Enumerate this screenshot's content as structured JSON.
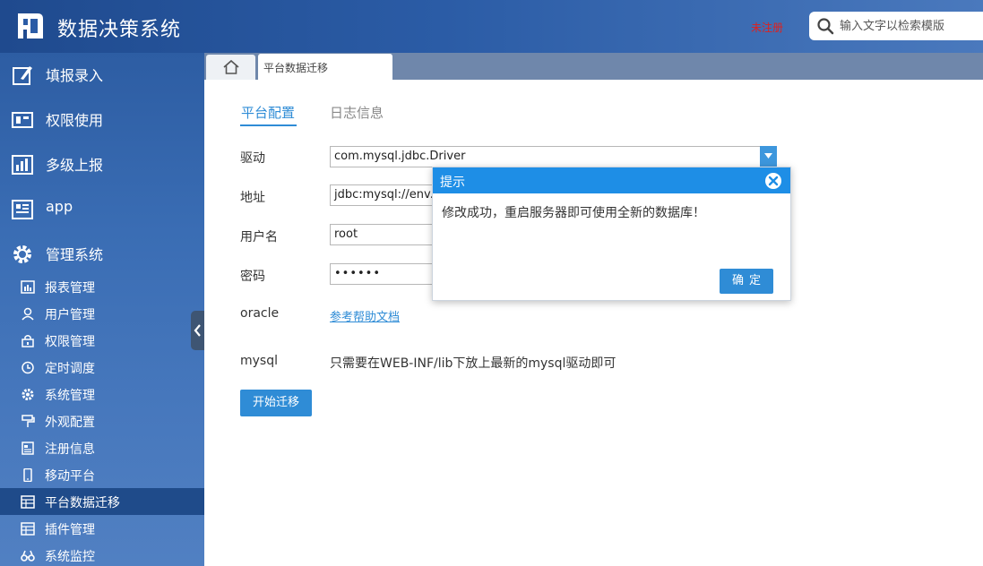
{
  "header": {
    "title": "数据决策系统",
    "unregistered": "未注册",
    "search_placeholder": "输入文字以检索模版"
  },
  "sidebar": {
    "main_items": [
      {
        "label": "填报录入",
        "icon": "edit-icon"
      },
      {
        "label": "权限使用",
        "icon": "permission-icon"
      },
      {
        "label": "多级上报",
        "icon": "chart-icon"
      },
      {
        "label": "app",
        "icon": "app-icon"
      },
      {
        "label": "管理系统",
        "icon": "gear-icon"
      }
    ],
    "sub_items": [
      {
        "label": "报表管理",
        "icon": "report-icon"
      },
      {
        "label": "用户管理",
        "icon": "user-icon"
      },
      {
        "label": "权限管理",
        "icon": "lock-icon"
      },
      {
        "label": "定时调度",
        "icon": "clock-icon"
      },
      {
        "label": "系统管理",
        "icon": "gear-icon"
      },
      {
        "label": "外观配置",
        "icon": "brush-icon"
      },
      {
        "label": "注册信息",
        "icon": "document-icon"
      },
      {
        "label": "移动平台",
        "icon": "phone-icon"
      },
      {
        "label": "平台数据迁移",
        "icon": "table-icon",
        "active": true
      },
      {
        "label": "插件管理",
        "icon": "table-icon"
      },
      {
        "label": "系统监控",
        "icon": "binoculars-icon"
      }
    ]
  },
  "tabs": {
    "open_tab": "平台数据迁移"
  },
  "content": {
    "subtabs": [
      "平台配置",
      "日志信息"
    ],
    "driver_label": "驱动",
    "driver_value": "com.mysql.jdbc.Driver",
    "address_label": "地址",
    "address_value": "jdbc:mysql://env.fine",
    "username_label": "用户名",
    "username_value": "root",
    "password_label": "密码",
    "password_value": "••••••",
    "oracle_label": "oracle",
    "oracle_link": "参考帮助文档",
    "mysql_label": "mysql",
    "mysql_note": "只需要在WEB-INF/lib下放上最新的mysql驱动即可",
    "start_button": "开始迁移"
  },
  "dialog": {
    "title": "提示",
    "message": "修改成功，重启服务器即可使用全新的数据库！",
    "ok": "确定"
  },
  "colors": {
    "accent": "#2f8cd6",
    "dialog_header": "#1e8ee6",
    "unregistered": "#e0201c"
  }
}
